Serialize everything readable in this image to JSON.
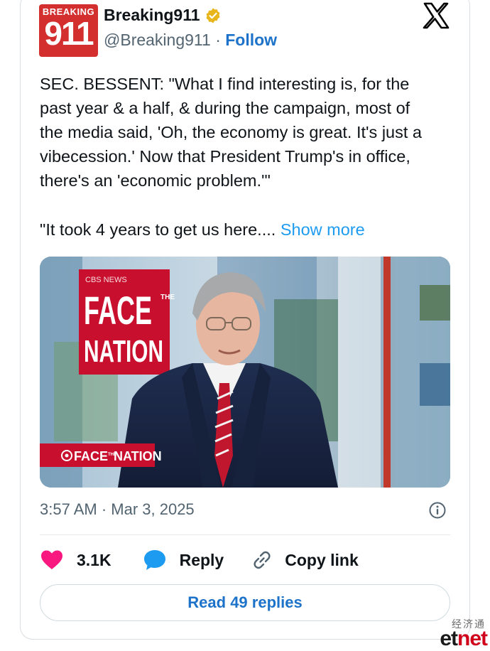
{
  "account": {
    "avatar_top": "BREAKING",
    "avatar_num": "911",
    "name": "Breaking911",
    "handle": "@Breaking911",
    "separator": "·",
    "follow_label": "Follow",
    "verified_icon": "verified-badge-icon"
  },
  "platform_icon": "x-logo-icon",
  "tweet": {
    "text_lines": [
      "SEC. BESSENT: \"What I find interesting is, for the",
      "past year & a half, & during the campaign, most of",
      "the media said, 'Oh, the economy is great. It's just a",
      "vibecession.' Now that President Trump's in office,",
      "there's an 'economic problem.'\""
    ],
    "truncated_line": "\"It took 4 years to get us here....",
    "show_more": "Show more"
  },
  "media": {
    "network_tag": "CBS NEWS",
    "show_word1": "FACE",
    "show_the": "THE",
    "show_word2": "NATION",
    "lower_third_a": "FACE",
    "lower_third_the": "THE",
    "lower_third_b": "NATION"
  },
  "meta": {
    "timestamp": "3:57 AM · Mar 3, 2025",
    "info_icon": "info-icon"
  },
  "actions": {
    "likes": "3.1K",
    "reply_label": "Reply",
    "copy_label": "Copy link"
  },
  "read_replies": "Read 49 replies",
  "watermark": {
    "chinese": "经济通",
    "brand_et": "et",
    "brand_net": "net"
  },
  "colors": {
    "accent_blue": "#1d9bf0",
    "follow_blue": "#1d72c9",
    "like_pink": "#f91880",
    "avatar_red": "#d32f2f",
    "text": "#0f1419",
    "muted": "#536471"
  }
}
